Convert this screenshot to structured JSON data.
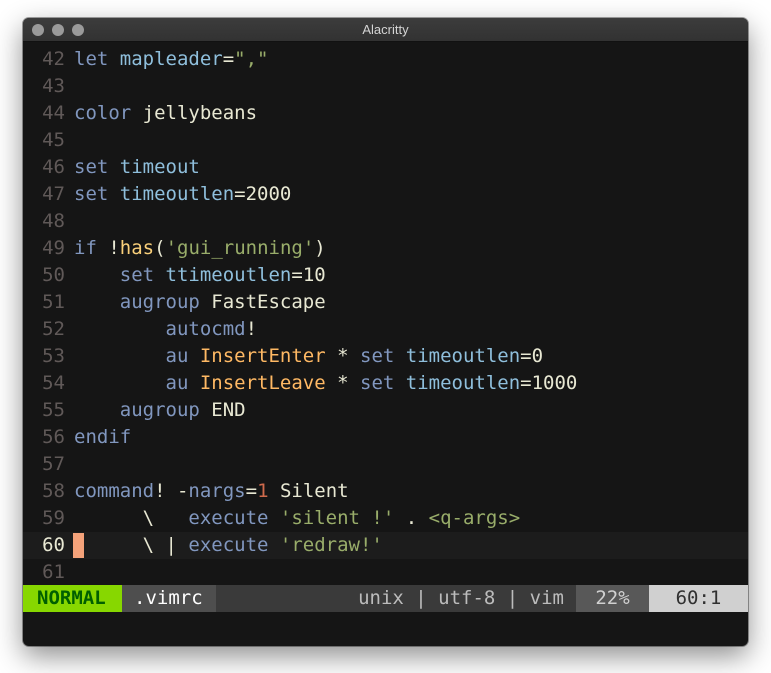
{
  "window": {
    "title": "Alacritty"
  },
  "lines": [
    {
      "n": "42",
      "tokens": [
        [
          "kw",
          "let "
        ],
        [
          "opt",
          "mapleader"
        ],
        [
          "plain",
          "="
        ],
        [
          "str",
          "\",\""
        ]
      ]
    },
    {
      "n": "43",
      "tokens": []
    },
    {
      "n": "44",
      "tokens": [
        [
          "kw",
          "color "
        ],
        [
          "plain",
          "jellybeans"
        ]
      ]
    },
    {
      "n": "45",
      "tokens": []
    },
    {
      "n": "46",
      "tokens": [
        [
          "kw",
          "set "
        ],
        [
          "opt",
          "timeout"
        ]
      ]
    },
    {
      "n": "47",
      "tokens": [
        [
          "kw",
          "set "
        ],
        [
          "opt",
          "timeoutlen"
        ],
        [
          "plain",
          "=2000"
        ]
      ]
    },
    {
      "n": "48",
      "tokens": []
    },
    {
      "n": "49",
      "tokens": [
        [
          "kw",
          "if "
        ],
        [
          "plain",
          "!"
        ],
        [
          "fn",
          "has"
        ],
        [
          "plain",
          "("
        ],
        [
          "str",
          "'gui_running'"
        ],
        [
          "plain",
          ")"
        ]
      ]
    },
    {
      "n": "50",
      "tokens": [
        [
          "plain",
          "    "
        ],
        [
          "kw",
          "set "
        ],
        [
          "opt",
          "ttimeoutlen"
        ],
        [
          "plain",
          "=10"
        ]
      ]
    },
    {
      "n": "51",
      "tokens": [
        [
          "plain",
          "    "
        ],
        [
          "kw",
          "augroup "
        ],
        [
          "plain",
          "FastEscape"
        ]
      ]
    },
    {
      "n": "52",
      "tokens": [
        [
          "plain",
          "        "
        ],
        [
          "kw",
          "autocmd"
        ],
        [
          "plain",
          "!"
        ]
      ]
    },
    {
      "n": "53",
      "tokens": [
        [
          "plain",
          "        "
        ],
        [
          "kw",
          "au "
        ],
        [
          "ev",
          "InsertEnter"
        ],
        [
          "plain",
          " * "
        ],
        [
          "kw",
          "set "
        ],
        [
          "opt",
          "timeoutlen"
        ],
        [
          "plain",
          "=0"
        ]
      ]
    },
    {
      "n": "54",
      "tokens": [
        [
          "plain",
          "        "
        ],
        [
          "kw",
          "au "
        ],
        [
          "ev",
          "InsertLeave"
        ],
        [
          "plain",
          " * "
        ],
        [
          "kw",
          "set "
        ],
        [
          "opt",
          "timeoutlen"
        ],
        [
          "plain",
          "=1000"
        ]
      ]
    },
    {
      "n": "55",
      "tokens": [
        [
          "plain",
          "    "
        ],
        [
          "kw",
          "augroup "
        ],
        [
          "plain",
          "END"
        ]
      ]
    },
    {
      "n": "56",
      "tokens": [
        [
          "kw",
          "endif"
        ]
      ]
    },
    {
      "n": "57",
      "tokens": []
    },
    {
      "n": "58",
      "tokens": [
        [
          "kw",
          "command"
        ],
        [
          "plain",
          "! -"
        ],
        [
          "kw",
          "nargs"
        ],
        [
          "plain",
          "="
        ],
        [
          "num",
          "1"
        ],
        [
          "plain",
          " Silent"
        ]
      ]
    },
    {
      "n": "59",
      "tokens": [
        [
          "plain",
          "      \\   "
        ],
        [
          "kw",
          "execute "
        ],
        [
          "str",
          "'silent !'"
        ],
        [
          "plain",
          " . "
        ],
        [
          "str",
          "<q-args>"
        ]
      ]
    },
    {
      "n": "60",
      "current": true,
      "tokens": [
        [
          "plain",
          "      \\ | "
        ],
        [
          "kw",
          "execute "
        ],
        [
          "str",
          "'redraw!'"
        ]
      ]
    },
    {
      "n": "61",
      "tokens": []
    }
  ],
  "statusline": {
    "mode": "NORMAL",
    "filename": ".vimrc",
    "fileinfo": "unix | utf-8 | vim",
    "percent": "22%",
    "position": "60:1"
  },
  "colors": {
    "mode_bg": "#87d700",
    "cursor": "#f4a27a",
    "background": "#151515"
  }
}
